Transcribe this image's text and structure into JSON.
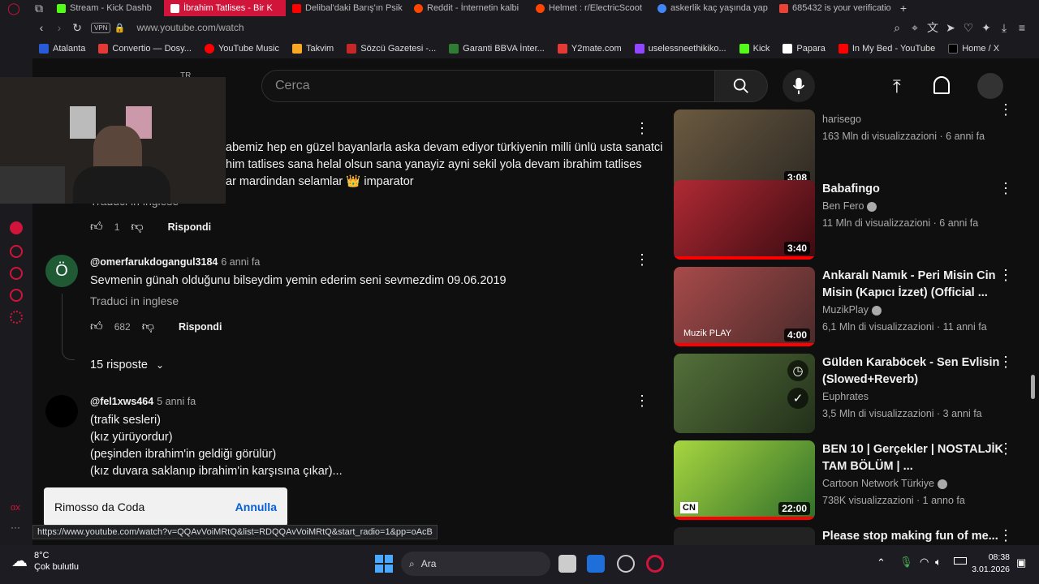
{
  "tabs": [
    {
      "label": "Stream - Kick Dashb",
      "color": "#53fc18",
      "active": false
    },
    {
      "label": "İbrahim Tatlises - Bir K",
      "color": "#ff0000",
      "active": true
    },
    {
      "label": "Delibal'daki Barış'ın Psik",
      "color": "#ff0000",
      "active": false
    },
    {
      "label": "Reddit - İnternetin kalbi",
      "color": "#ff4500",
      "active": false
    },
    {
      "label": "Helmet : r/ElectricScoot",
      "color": "#ff4500",
      "active": false
    },
    {
      "label": "askerlik kaç yaşında yap",
      "color": "#4285f4",
      "active": false
    },
    {
      "label": "685432 is your verificatio",
      "color": "#ea4335",
      "active": false
    }
  ],
  "address": {
    "vpn": "VPN",
    "url": "www.youtube.com/watch"
  },
  "bookmarks": [
    {
      "label": "Atalanta",
      "color": "#2a5bd7"
    },
    {
      "label": "Convertio — Dosy...",
      "color": "#e53935"
    },
    {
      "label": "YouTube Music",
      "color": "#ff0000"
    },
    {
      "label": "Takvim",
      "color": "#f9a825"
    },
    {
      "label": "Sözcü Gazetesi -...",
      "color": "#c62828"
    },
    {
      "label": "Garanti BBVA İnter...",
      "color": "#2e7d32"
    },
    {
      "label": "Y2mate.com",
      "color": "#e53935"
    },
    {
      "label": "uselessneethikiko...",
      "color": "#9146ff"
    },
    {
      "label": "Kick",
      "color": "#53fc18"
    },
    {
      "label": "Papara",
      "color": "#ffffff"
    },
    {
      "label": "In My Bed - YouTube",
      "color": "#ff0000"
    },
    {
      "label": "Home / X",
      "color": "#000000"
    }
  ],
  "header": {
    "search_placeholder": "Cerca",
    "webcam_tag": "TR"
  },
  "comments": {
    "first": {
      "lines": [
        "abemiz hep en güzel bayanlarla aska devam ediyor türkiyenin milli ünlü usta sanatci",
        "him tatlises sana helal olsun sana yanayiz ayni sekil yola devam ibrahim tatlises",
        "ar mardindan selamlar 👑 imparator"
      ],
      "translate": "Traduci in inglese",
      "likes": "1",
      "reply": "Rispondi"
    },
    "second": {
      "avatar_letter": "Ö",
      "author": "@omerfarukdogangul3184",
      "ago": "6 anni fa",
      "text": "Sevmenin günah olduğunu bilseydim yemin ederim seni sevmezdim 09.06.2019",
      "translate": "Traduci in inglese",
      "likes": "682",
      "reply": "Rispondi",
      "replies": "15 risposte"
    },
    "third": {
      "author": "@fel1xws464",
      "ago": "5 anni fa",
      "lines": [
        "(trafik sesleri)",
        "(kız yürüyordur)",
        "(peşinden ibrahim'in geldiği görülür)",
        "(kız duvara saklanıp ibrahim'in karşısına çıkar)..."
      ]
    }
  },
  "related": [
    {
      "title": "",
      "channel": "harisego",
      "views": "163 Mln di visualizzazioni · 6 anni fa",
      "duration": "3:08",
      "verified": false,
      "thumb": "#5a4a35"
    },
    {
      "title": "Babafingo",
      "channel": "Ben Fero",
      "views": "11 Mln di visualizzazioni · 6 anni fa",
      "duration": "3:40",
      "verified": true,
      "thumb": "#8a1e26"
    },
    {
      "title": "Ankaralı Namık - Peri Misin Cin Misin (Kapıcı İzzet) (Official ...",
      "channel": "MuzikPlay",
      "views": "6,1 Mln di visualizzazioni · 11 anni fa",
      "duration": "4:00",
      "verified": true,
      "thumb": "#8c3a3a",
      "thumb_label": "Muzik PLAY"
    },
    {
      "title": "Gülden Karaböcek - Sen Evlisin (Slowed+Reverb)",
      "channel": "Euphrates",
      "views": "3,5 Mln di visualizzazioni · 3 anni fa",
      "duration": "",
      "verified": false,
      "thumb": "#3f5a2a"
    },
    {
      "title": "BEN 10 | Gerçekler | NOSTALJİK TAM BÖLÜM | ...",
      "channel": "Cartoon Network Türkiye",
      "views": "738K visualizzazioni · 1 anno fa",
      "duration": "22:00",
      "verified": true,
      "thumb": "#2d6e2a",
      "thumb_label": "CN"
    },
    {
      "title": "Please stop making fun of me...",
      "channel": "",
      "views": "",
      "duration": "",
      "verified": false,
      "thumb": "#222"
    }
  ],
  "toast": {
    "text": "Rimosso da Coda",
    "action": "Annulla"
  },
  "status_url": "https://www.youtube.com/watch?v=QQAvVoiMRtQ&list=RDQQAvVoiMRtQ&start_radio=1&pp=oAcB",
  "taskbar": {
    "temp": "8°C",
    "weather": "Çok bulutlu",
    "search": "Ara",
    "time": "08:38",
    "date": "3.01.2026"
  }
}
